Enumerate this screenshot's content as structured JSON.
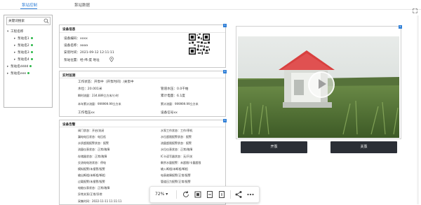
{
  "tabs": [
    {
      "label": "泵站控制",
      "active": true
    },
    {
      "label": "泵站数据",
      "active": false
    }
  ],
  "tree": {
    "search_placeholder": "关键词搜索",
    "nodes": [
      {
        "label": "工程名称",
        "level": 0,
        "caret": "▾"
      },
      {
        "label": "泵站名1",
        "level": 1,
        "online": true
      },
      {
        "label": "泵站名2",
        "level": 1,
        "online": true
      },
      {
        "label": "泵站名3",
        "level": 1,
        "online": true
      },
      {
        "label": "泵站名4",
        "level": 1,
        "online": true
      },
      {
        "label": "泵站名dddd",
        "level": 0,
        "online": true
      },
      {
        "label": "泵站名eee",
        "level": 0,
        "online": true
      }
    ]
  },
  "device_info": {
    "title": "设备信息",
    "badge": "1",
    "code_label": "设备编码：",
    "code_value": "xxxx",
    "name_label": "设备名称：",
    "name_value": "aaaa",
    "install_label": "安装时间：",
    "install_value": "2021-09-12 12:11:11",
    "location_label": "泵站位置：",
    "location_value": "经-纬-度 地址"
  },
  "realtime": {
    "title": "实时监测",
    "badge": "4",
    "status": "工作状态：开泵中（开泵时间）/关泵中",
    "water_level": "水位：20.001米",
    "pipe_pressure": "管道水压：0.0千帕",
    "instant_flow": "瞬时流量：234.889立方米/小时",
    "total_power": "累计电量：6.1度",
    "year_flow": "本年累计流量：999999.99立方米",
    "total_flow": "累计流量：999999.99立方米",
    "voltage": "工作电压xx",
    "signal": "设备信号xx"
  },
  "device_status": {
    "title": "设备告警",
    "badge": "3",
    "left": [
      "阀门状态：开启/关闭",
      "漏电电压状态：电压低",
      "水质超限报警状态：报警",
      "流量仪表状态：正常/故障",
      "存储器状态：正常/故障",
      "交流电电池状态：停电",
      "模拟报警/未报警/报警",
      "输出断相/未断相/断相",
      "过载报警/未报警/报警",
      "电能仪表状态：正常/故障",
      "异常关泵/正常/异常"
    ],
    "right": [
      "水泵工作状态：工作/停机",
      "水位超限报警状态：报警",
      "流量超限报警状态：报警",
      "水位仪表状态：正常/故障",
      "IC卡读写器状态：无/开关",
      "剩余水量报警：未超限/卡量超限",
      "输入断相/未断相/断相",
      "电表故障报警/正常/报警",
      "管道压力报警/正常/报警"
    ],
    "update_time": "采集时间：2022-11-11 11:11:11"
  },
  "video": {
    "badge": "5"
  },
  "buttons": {
    "open": "开泵",
    "close": "关泵"
  },
  "toolbar": {
    "zoom": "72%"
  }
}
